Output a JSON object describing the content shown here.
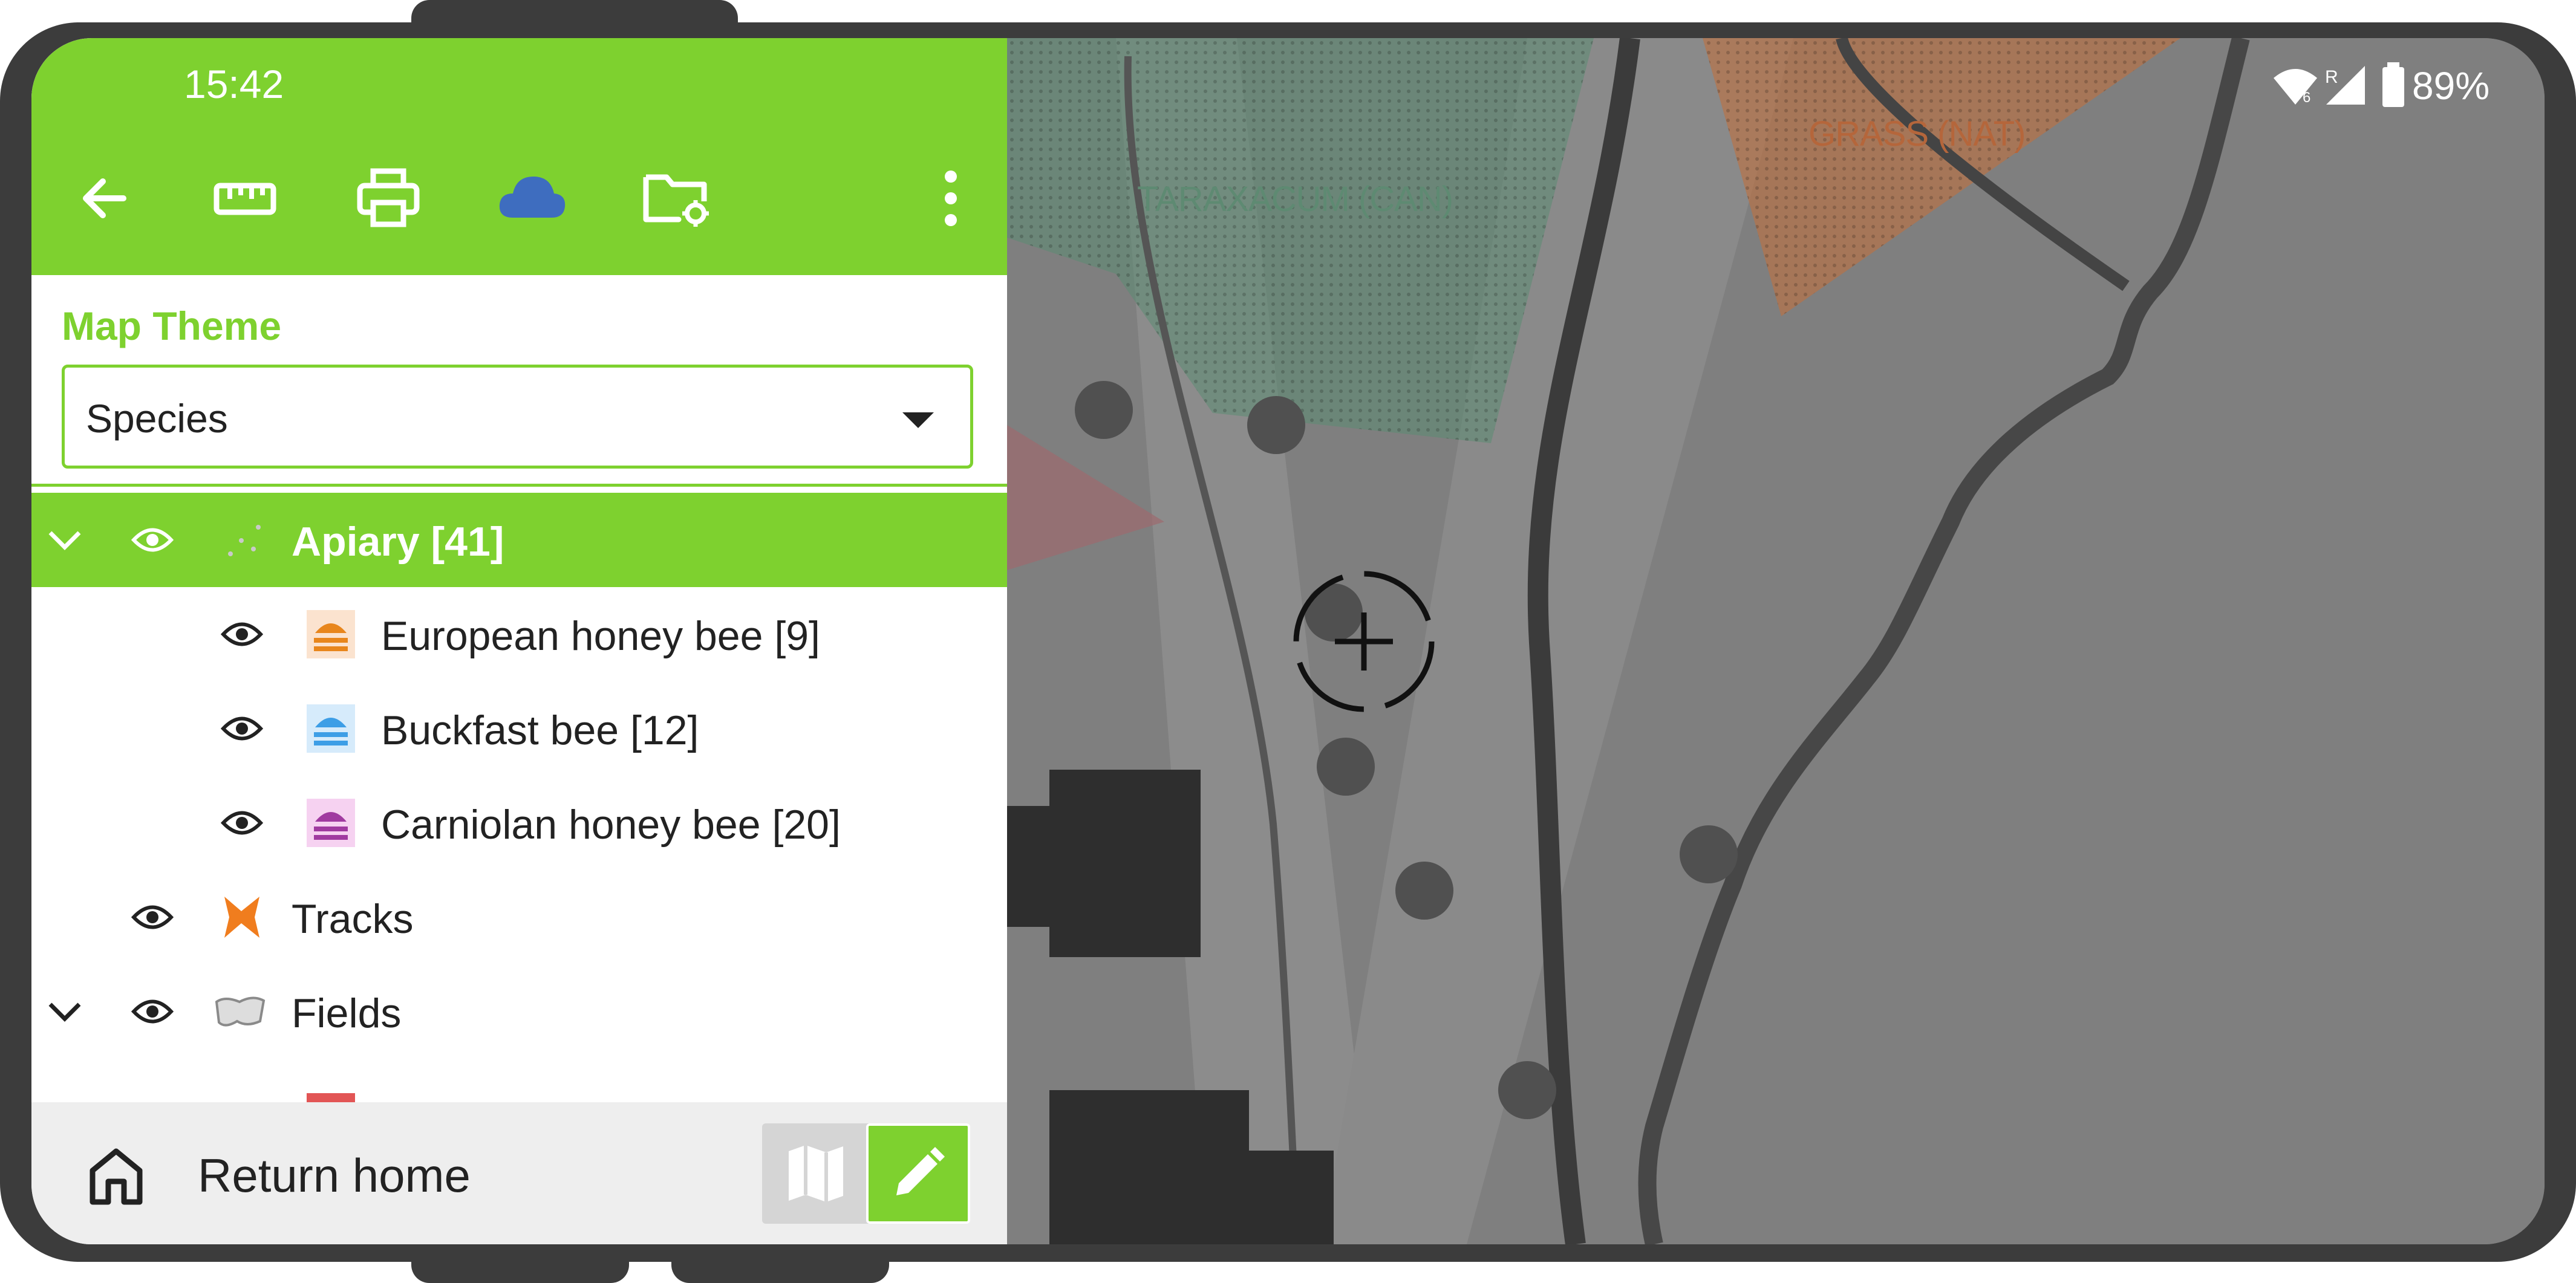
{
  "status_bar": {
    "time": "15:42",
    "battery": "89%"
  },
  "toolbar": {
    "icons": [
      "back-arrow-icon",
      "ruler-icon",
      "printer-icon",
      "cloud-icon",
      "folder-settings-icon",
      "more-vert-icon"
    ]
  },
  "map_theme": {
    "label": "Map Theme",
    "selected": "Species"
  },
  "layers": [
    {
      "label": "Apiary [41]",
      "expanded": true,
      "selected": true
    },
    {
      "label": "European honey bee [9]",
      "color": "#e8861c"
    },
    {
      "label": "Buckfast bee [12]",
      "color": "#3d9ee6"
    },
    {
      "label": "Carniolan honey bee [20]",
      "color": "#a03aa0"
    },
    {
      "label": "Tracks"
    },
    {
      "label": "Fields",
      "expanded": true
    }
  ],
  "map": {
    "labels": {
      "grass": "GRASS (NAT)",
      "taraxacum": "TARAXACUM (CAN)"
    }
  },
  "bottom_bar": {
    "home_label": "Return home"
  },
  "colors": {
    "accent": "#7ed12f",
    "map_bg": "#7f7f7f"
  }
}
